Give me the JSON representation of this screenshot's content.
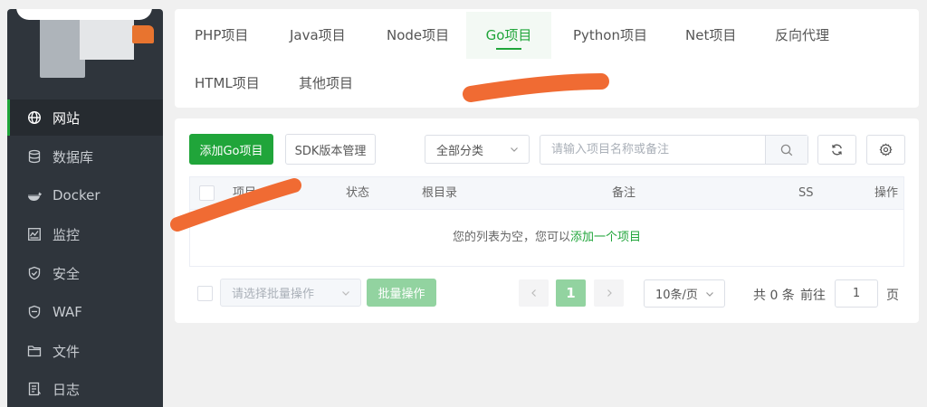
{
  "sidebar": {
    "items": [
      {
        "label": "网站",
        "icon": "globe-icon",
        "active": true
      },
      {
        "label": "数据库",
        "icon": "database-icon"
      },
      {
        "label": "Docker",
        "icon": "docker-icon"
      },
      {
        "label": "监控",
        "icon": "monitor-icon"
      },
      {
        "label": "安全",
        "icon": "shield-icon"
      },
      {
        "label": "WAF",
        "icon": "waf-shield-icon"
      },
      {
        "label": "文件",
        "icon": "folder-icon"
      },
      {
        "label": "日志",
        "icon": "log-icon"
      }
    ]
  },
  "tabs": [
    {
      "label": "PHP项目"
    },
    {
      "label": "Java项目"
    },
    {
      "label": "Node项目"
    },
    {
      "label": "Go项目",
      "active": true
    },
    {
      "label": "Python项目"
    },
    {
      "label": "Net项目"
    },
    {
      "label": "反向代理"
    },
    {
      "label": "HTML项目"
    },
    {
      "label": "其他项目"
    }
  ],
  "toolbar": {
    "add_label": "添加Go项目",
    "sdk_label": "SDK版本管理",
    "category_value": "全部分类",
    "search_placeholder": "请输入项目名称或备注",
    "search_icon": "search-icon",
    "refresh_icon": "refresh-icon",
    "settings_icon": "gear-icon"
  },
  "table": {
    "columns": [
      "项目",
      "状态",
      "根目录",
      "备注",
      "SS",
      "操作"
    ],
    "empty_text": "您的列表为空，您可以",
    "empty_link": "添加一个项目"
  },
  "footer": {
    "batch_placeholder": "请选择批量操作",
    "batch_button": "批量操作",
    "current_page": "1",
    "page_size": "10条/页",
    "total_text": "共 0 条",
    "goto_label": "前往",
    "goto_value": "1",
    "page_suffix": "页"
  },
  "colors": {
    "accent": "#20a53a",
    "sidebar_bg": "#2f353c",
    "redaction": "#f06b33"
  }
}
